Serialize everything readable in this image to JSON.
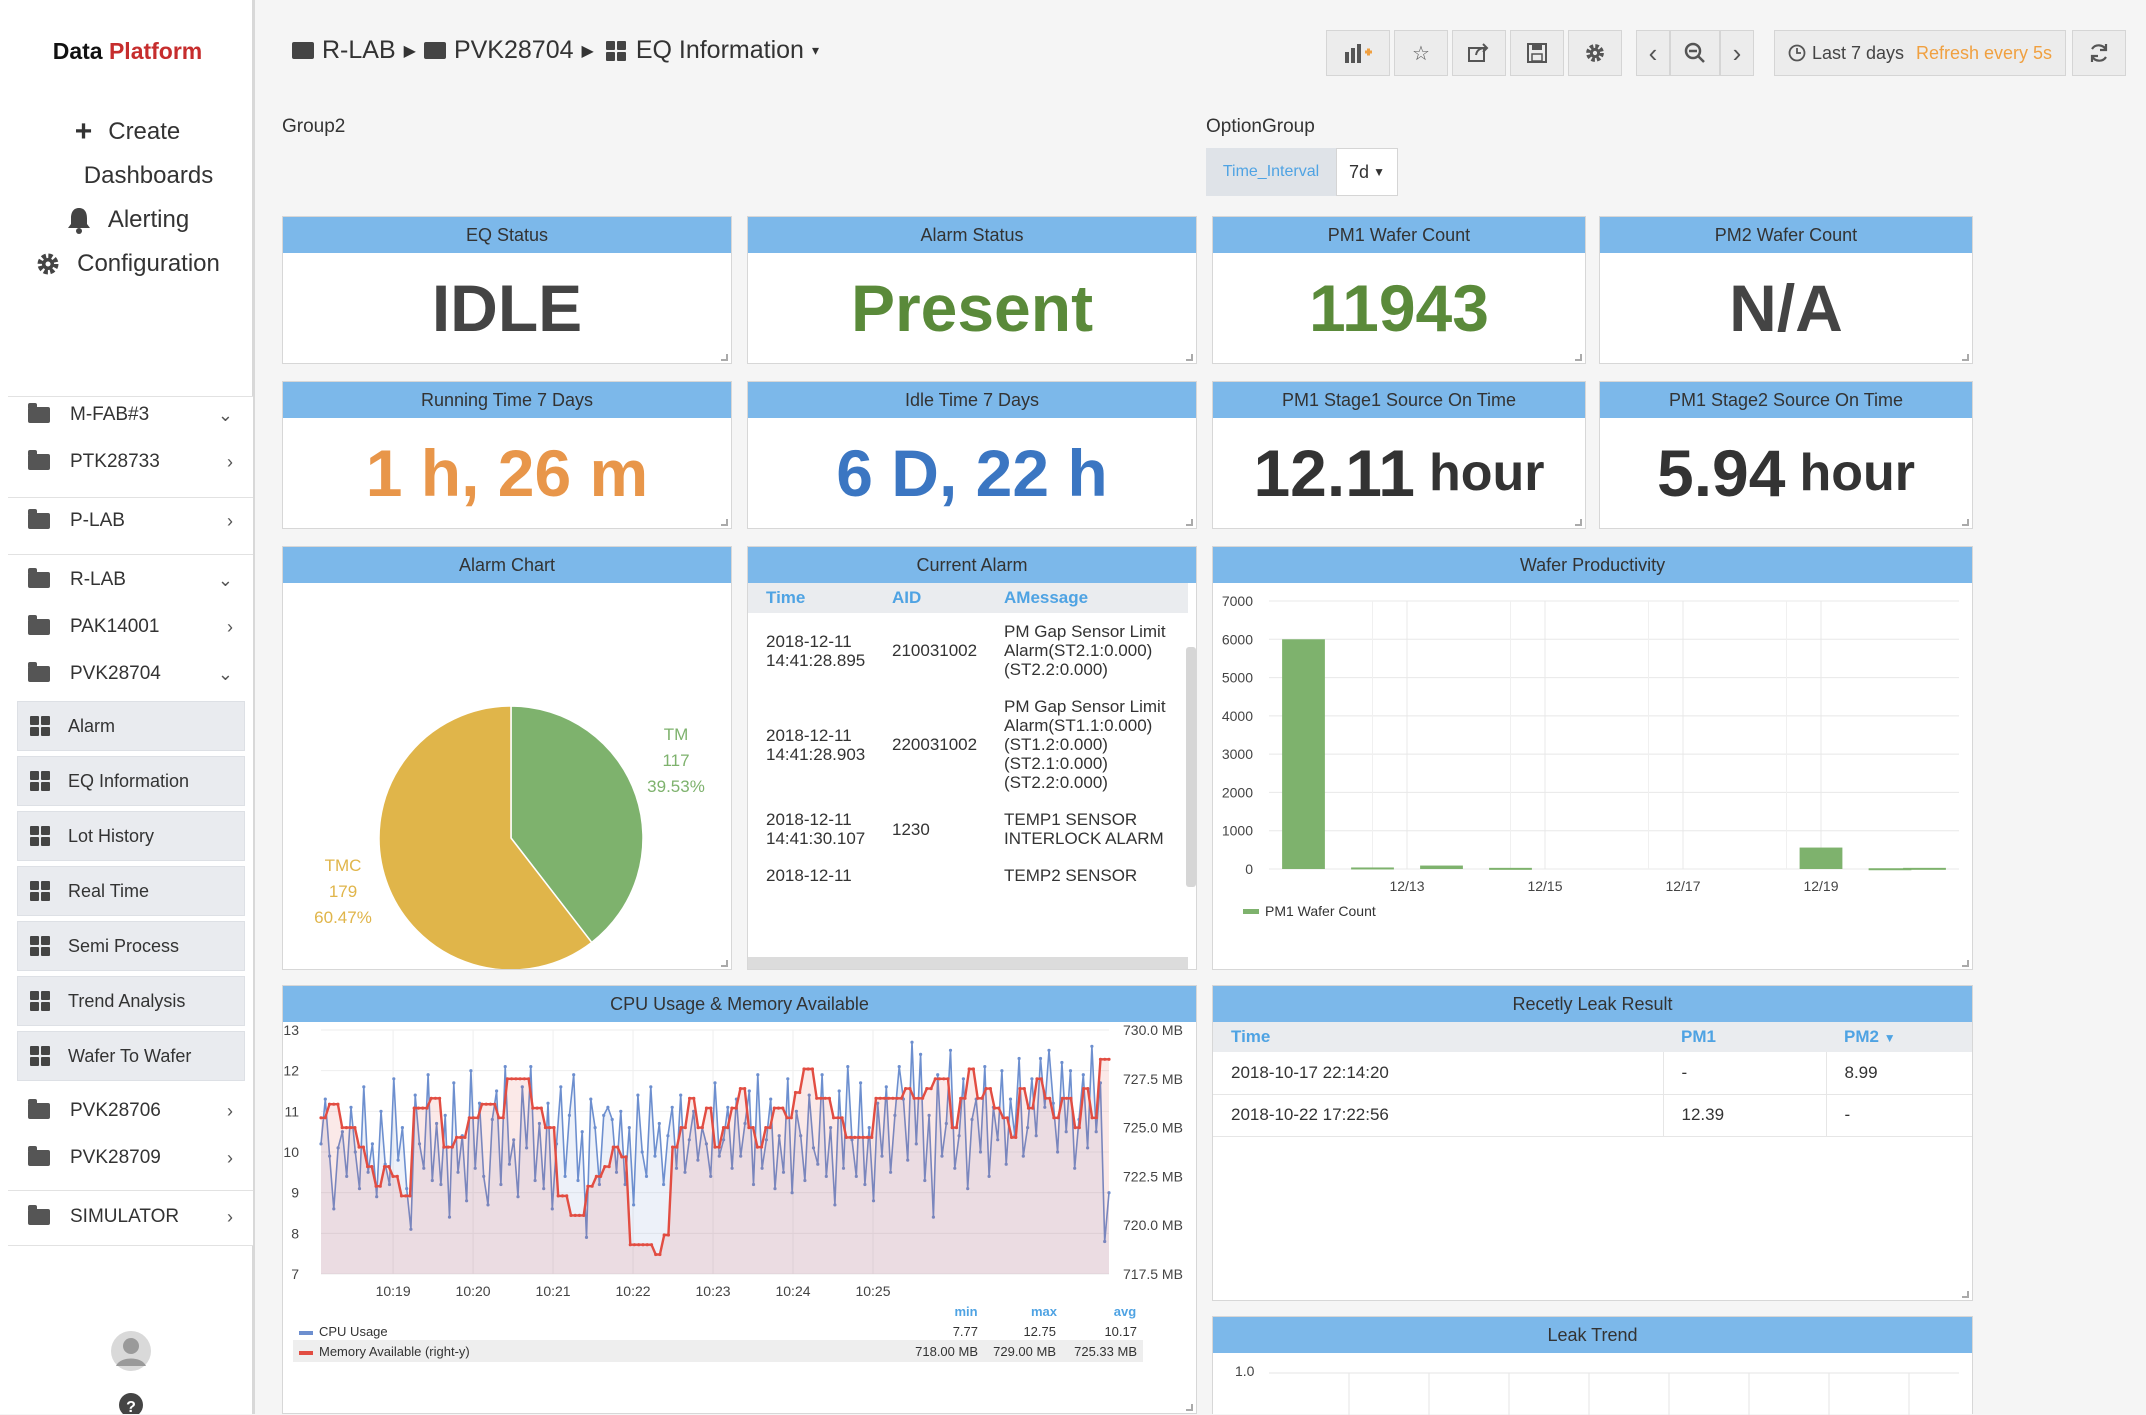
{
  "brand": {
    "part1": "Data ",
    "part2": "Platform"
  },
  "mainnav": {
    "create": "Create",
    "dashboards": "Dashboards",
    "alerting": "Alerting",
    "configuration": "Configuration"
  },
  "tree": {
    "mfab": "M-FAB#3",
    "ptk": "PTK28733",
    "plab": "P-LAB",
    "rlab": "R-LAB",
    "pak": "PAK14001",
    "pvk28704": "PVK28704",
    "dashboards": [
      "Alarm",
      "EQ Information",
      "Lot History",
      "Real Time",
      "Semi Process",
      "Trend Analysis",
      "Wafer To Wafer"
    ],
    "pvk28706": "PVK28706",
    "pvk28709": "PVK28709",
    "simulator": "SIMULATOR"
  },
  "breadcrumb": {
    "b1": "R-LAB",
    "b2": "PVK28704",
    "b3": "EQ Information"
  },
  "toolbar": {
    "time_range": "Last 7 days",
    "refresh": "Refresh every 5s"
  },
  "groups": {
    "group2": "Group2",
    "optiongroup": "OptionGroup",
    "time_interval_label": "Time_Interval",
    "time_interval_value": "7d"
  },
  "stats": {
    "eq_status": {
      "title": "EQ Status",
      "value": "IDLE",
      "color": "#444444"
    },
    "alarm_status": {
      "title": "Alarm Status",
      "value": "Present",
      "color": "#5a8a3a"
    },
    "pm1_count": {
      "title": "PM1 Wafer Count",
      "value": "11943",
      "color": "#5a8a3a"
    },
    "pm2_count": {
      "title": "PM2 Wafer Count",
      "value": "N/A",
      "color": "#444444"
    },
    "running_time": {
      "title": "Running Time 7 Days",
      "value": "1 h, 26 m",
      "color": "#e8964a"
    },
    "idle_time": {
      "title": "Idle Time 7 Days",
      "value": "6 D, 22 h",
      "color": "#3b76c2"
    },
    "pm1_stage1": {
      "title": "PM1 Stage1 Source On Time",
      "value": "12.11",
      "unit": "hour",
      "color": "#333333"
    },
    "pm1_stage2": {
      "title": "PM1 Stage2 Source On Time",
      "value": "5.94",
      "unit": "hour",
      "color": "#333333"
    }
  },
  "alarm_chart": {
    "title": "Alarm Chart"
  },
  "current_alarm": {
    "title": "Current Alarm",
    "columns": [
      "Time",
      "AID",
      "AMessage"
    ],
    "rows": [
      {
        "time": [
          "2018-12-11",
          "14:41:28.895"
        ],
        "aid": "210031002",
        "msg": [
          "PM Gap Sensor Limit",
          "Alarm(ST2.1:0.000)",
          "(ST2.2:0.000)"
        ]
      },
      {
        "time": [
          "2018-12-11",
          "14:41:28.903"
        ],
        "aid": "220031002",
        "msg": [
          "PM Gap Sensor Limit",
          "Alarm(ST1.1:0.000)",
          "(ST1.2:0.000)",
          "(ST2.1:0.000)",
          "(ST2.2:0.000)"
        ]
      },
      {
        "time": [
          "2018-12-11",
          "14:41:30.107"
        ],
        "aid": "1230",
        "msg": [
          "TEMP1 SENSOR",
          "INTERLOCK ALARM"
        ]
      },
      {
        "time": [
          "2018-12-11",
          ""
        ],
        "aid": "",
        "msg": [
          "TEMP2 SENSOR"
        ]
      }
    ]
  },
  "wafer_productivity": {
    "title": "Wafer Productivity"
  },
  "cpu_panel": {
    "title": "CPU Usage & Memory Available",
    "legend_headers": [
      "min",
      "max",
      "avg"
    ],
    "legend": [
      {
        "name": "CPU Usage",
        "suffix": "",
        "min": "7.77",
        "max": "12.75",
        "avg": "10.17"
      },
      {
        "name": "Memory Available",
        "suffix": "(right-y)",
        "min": "718.00 MB",
        "max": "729.00 MB",
        "avg": "725.33 MB"
      }
    ]
  },
  "leak_result": {
    "title": "Recetly Leak Result",
    "columns": [
      "Time",
      "PM1",
      "PM2"
    ],
    "rows": [
      [
        "2018-10-17 22:14:20",
        "-",
        "8.99"
      ],
      [
        "2018-10-22 17:22:56",
        "12.39",
        "-"
      ]
    ]
  },
  "leak_trend": {
    "title": "Leak Trend",
    "y_first_tick": "1.0"
  },
  "chart_data": [
    {
      "type": "pie",
      "title": "Alarm Chart",
      "slices": [
        {
          "label": "TM",
          "value": 117,
          "percent": "39.53%",
          "color": "#7eb26d"
        },
        {
          "label": "TMC",
          "value": 179,
          "percent": "60.47%",
          "color": "#e0b54a"
        }
      ]
    },
    {
      "type": "bar",
      "title": "Wafer Productivity",
      "ylim": [
        0,
        7000
      ],
      "yticks": [
        "0",
        "1000",
        "2000",
        "3000",
        "4000",
        "5000",
        "6000",
        "7000"
      ],
      "xticks": [
        "12/13",
        "12/15",
        "12/17",
        "12/19"
      ],
      "series": [
        {
          "name": "PM1 Wafer Count",
          "color": "#7eb26d",
          "points": [
            {
              "x": "12/11 12:00",
              "y": 6000
            },
            {
              "x": "12/12 12:00",
              "y": 40
            },
            {
              "x": "12/13 12:00",
              "y": 90
            },
            {
              "x": "12/14 12:00",
              "y": 30
            },
            {
              "x": "12/19 00:00",
              "y": 560
            },
            {
              "x": "12/20 00:00",
              "y": 20
            },
            {
              "x": "12/20 12:00",
              "y": 30
            }
          ]
        }
      ]
    },
    {
      "type": "line",
      "title": "CPU Usage & Memory Available",
      "xticks": [
        "10:19",
        "10:20",
        "10:21",
        "10:22",
        "10:23",
        "10:24",
        "10:25"
      ],
      "y_left": {
        "ticks": [
          "7",
          "8",
          "9",
          "10",
          "11",
          "12",
          "13"
        ],
        "ylim": [
          7,
          13
        ]
      },
      "y_right": {
        "ticks": [
          "717.5 MB",
          "720.0 MB",
          "722.5 MB",
          "725.0 MB",
          "727.5 MB",
          "730.0 MB"
        ],
        "ylim": [
          717.5,
          730.0
        ]
      },
      "series": [
        {
          "name": "CPU Usage",
          "axis": "left",
          "color": "#6d8fcf",
          "values": [
            10.2,
            11.3,
            9.9,
            8.6,
            10.1,
            10.5,
            9.4,
            11.1,
            10.0,
            9.1,
            11.6,
            9.5,
            10.2,
            8.9,
            11.0,
            9.7,
            9.2,
            11.8,
            9.8,
            10.6,
            9.1,
            8.1,
            11.4,
            10.2,
            9.6,
            11.9,
            9.3,
            10.7,
            9.2,
            10.9,
            8.4,
            11.7,
            9.5,
            10.4,
            8.8,
            12.0,
            9.6,
            11.2,
            9.4,
            8.7,
            10.8,
            11.5,
            9.2,
            12.1,
            9.7,
            10.3,
            8.9,
            11.6,
            10.1,
            12.1,
            9.3,
            10.7,
            9.1,
            11.2,
            8.6,
            10.2,
            11.6,
            9.4,
            10.9,
            11.9,
            9.3,
            10.5,
            7.9,
            11.3,
            10.6,
            9.2,
            10.9,
            11.1,
            10.8,
            9.5,
            11.0,
            9.2,
            10.6,
            8.7,
            11.4,
            10.0,
            9.4,
            11.6,
            9.9,
            10.7,
            9.2,
            10.4,
            11.1,
            9.6,
            11.4,
            9.5,
            10.3,
            11.0,
            9.8,
            10.6,
            10.2,
            9.4,
            11.7,
            9.9,
            10.3,
            11.1,
            9.6,
            11.3,
            9.9,
            10.7,
            11.5,
            9.2,
            11.9,
            9.6,
            10.3,
            11.3,
            9.1,
            10.4,
            9.5,
            11.8,
            9.0,
            11.0,
            10.4,
            9.3,
            11.4,
            10.1,
            9.7,
            11.9,
            9.4,
            10.6,
            8.7,
            11.5,
            9.6,
            12.1,
            10.3,
            9.4,
            11.7,
            9.2,
            10.6,
            8.8,
            11.2,
            9.9,
            11.6,
            9.5,
            10.9,
            12.1,
            11.3,
            9.8,
            12.7,
            10.2,
            12.4,
            9.3,
            10.9,
            8.4,
            11.9,
            9.9,
            10.7,
            12.5,
            9.6,
            10.4,
            11.8,
            9.1,
            10.8,
            11.3,
            10.0,
            12.1,
            9.4,
            11.1,
            10.3,
            12.0,
            9.7,
            11.3,
            10.4,
            12.3,
            9.9,
            10.6,
            11.8,
            10.4,
            12.3,
            11.1,
            12.5,
            11.2,
            10.0,
            12.2,
            10.5,
            12.0,
            9.6,
            10.8,
            11.9,
            10.1,
            12.6,
            10.5,
            11.7,
            7.8,
            9.0
          ]
        },
        {
          "name": "Memory Available",
          "axis": "right",
          "color": "#e24d42",
          "values": [
            725.5,
            725.5,
            726.2,
            726.2,
            726.2,
            725.0,
            725.0,
            725.0,
            725.0,
            724.0,
            724.0,
            723.0,
            723.0,
            722.0,
            722.0,
            723.0,
            723.0,
            722.5,
            722.5,
            721.5,
            721.5,
            721.5,
            726.0,
            726.0,
            726.0,
            726.0,
            726.5,
            726.5,
            726.5,
            724.0,
            724.0,
            724.0,
            724.5,
            724.5,
            724.5,
            725.5,
            725.5,
            725.5,
            726.2,
            726.2,
            726.2,
            726.2,
            725.5,
            725.5,
            727.5,
            727.5,
            727.5,
            727.5,
            727.5,
            727.5,
            726.0,
            726.0,
            726.0,
            725.0,
            725.0,
            725.0,
            721.5,
            721.5,
            721.5,
            720.5,
            720.5,
            720.5,
            720.5,
            722.0,
            722.0,
            722.5,
            722.5,
            723.0,
            723.0,
            724.0,
            724.0,
            723.5,
            723.5,
            719.0,
            719.0,
            719.0,
            719.0,
            719.0,
            719.0,
            718.5,
            718.5,
            719.5,
            719.5,
            724.0,
            724.0,
            725.0,
            725.0,
            726.5,
            726.5,
            725.0,
            725.0,
            726.0,
            726.0,
            724.0,
            724.0,
            725.0,
            725.0,
            726.0,
            726.0,
            727.0,
            727.0,
            725.0,
            725.0,
            724.0,
            724.0,
            725.0,
            725.0,
            726.0,
            726.0,
            726.0,
            725.5,
            725.5,
            726.8,
            726.8,
            728.0,
            728.0,
            728.0,
            726.5,
            726.5,
            726.5,
            726.5,
            725.5,
            725.5,
            725.5,
            724.5,
            724.5,
            724.5,
            724.5,
            724.5,
            724.5,
            724.5,
            726.5,
            726.5,
            726.5,
            726.5,
            726.5,
            726.5,
            726.5,
            727.0,
            727.0,
            726.5,
            726.5,
            726.5,
            727.0,
            727.0,
            727.5,
            727.5,
            727.5,
            727.5,
            725.0,
            725.0,
            726.5,
            726.5,
            728.0,
            728.0,
            726.5,
            726.5,
            727.0,
            727.0,
            726.0,
            726.0,
            725.5,
            725.5,
            724.5,
            724.5,
            727.0,
            727.0,
            726.0,
            726.0,
            727.5,
            727.5,
            726.5,
            726.5,
            725.5,
            725.5,
            726.5,
            726.5,
            726.5,
            725.0,
            725.0,
            727.0,
            727.0,
            725.5,
            725.5,
            728.5,
            728.5,
            728.5
          ]
        }
      ]
    }
  ]
}
